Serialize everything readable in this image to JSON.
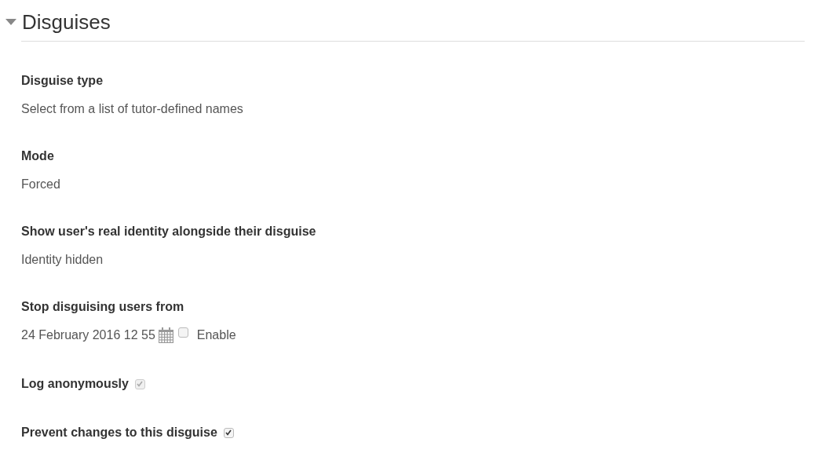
{
  "section": {
    "title": "Disguises",
    "expanded": true
  },
  "fields": [
    {
      "kind": "text",
      "label": "Disguise type",
      "value": "Select from a list of tutor-defined names"
    },
    {
      "kind": "text",
      "label": "Mode",
      "value": "Forced"
    },
    {
      "kind": "text",
      "label": "Show user's real identity alongside their disguise",
      "value": "Identity hidden"
    },
    {
      "kind": "date",
      "label": "Stop disguising users from",
      "value": "24 February 2016 12 55",
      "enable_label": "Enable",
      "checked": false
    },
    {
      "kind": "checkbox",
      "label": "Log anonymously",
      "checked": true,
      "disabled": true
    },
    {
      "kind": "checkbox",
      "label": "Prevent changes to this disguise",
      "checked": true,
      "disabled": false
    }
  ]
}
